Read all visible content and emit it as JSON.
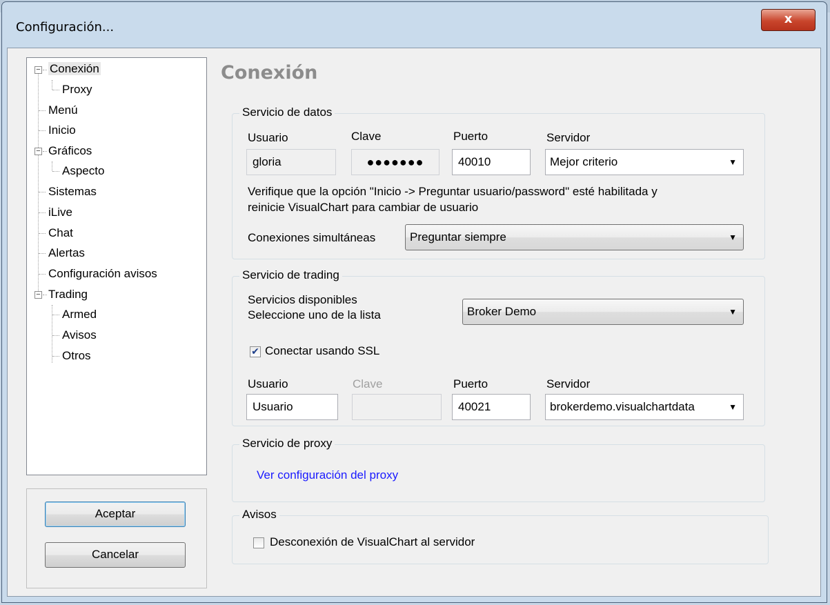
{
  "window": {
    "title": "Configuración...",
    "close_label": "x"
  },
  "tree": {
    "items": [
      {
        "label": "Conexión"
      },
      {
        "label": "Proxy"
      },
      {
        "label": "Menú"
      },
      {
        "label": "Inicio"
      },
      {
        "label": "Gráficos"
      },
      {
        "label": "Aspecto"
      },
      {
        "label": "Sistemas"
      },
      {
        "label": "iLive"
      },
      {
        "label": "Chat"
      },
      {
        "label": "Alertas"
      },
      {
        "label": "Configuración avisos"
      },
      {
        "label": "Trading"
      },
      {
        "label": "Armed"
      },
      {
        "label": "Avisos"
      },
      {
        "label": "Otros"
      }
    ],
    "expander_symbol": "−"
  },
  "buttons": {
    "accept": "Aceptar",
    "cancel": "Cancelar"
  },
  "page_title": "Conexión",
  "data_service": {
    "group_label": "Servicio de datos",
    "user_label": "Usuario",
    "user_value": "gloria",
    "password_label": "Clave",
    "password_value": "●●●●●●●",
    "port_label": "Puerto",
    "port_value": "40010",
    "server_label": "Servidor",
    "server_value": "Mejor criterio",
    "note_line1": "Verifique que la opción \"Inicio -> Preguntar usuario/password\" esté habilitada y",
    "note_line2": "reinicie VisualChart para cambiar de usuario",
    "simultaneous_label": "Conexiones simultáneas",
    "simultaneous_value": "Preguntar siempre"
  },
  "trading_service": {
    "group_label": "Servicio de trading",
    "available_label": "Servicios disponibles",
    "select_hint": "Seleccione uno de la lista",
    "broker_value": "Broker Demo",
    "ssl_label": "Conectar usando SSL",
    "ssl_checked": true,
    "ssl_check_mark": "✔",
    "user_label": "Usuario",
    "user_value": "Usuario",
    "password_label": "Clave",
    "password_value": "",
    "port_label": "Puerto",
    "port_value": "40021",
    "server_label": "Servidor",
    "server_value": "brokerdemo.visualchartdata"
  },
  "proxy_service": {
    "group_label": "Servicio de proxy",
    "link_text": "Ver configuración del proxy"
  },
  "alerts": {
    "group_label": "Avisos",
    "disconnect_label": "Desconexión de VisualChart al servidor",
    "disconnect_checked": false
  },
  "dropdown_arrow": "▼",
  "colors": {
    "title_gray": "#8c8c8c",
    "link_blue": "#1a1aff",
    "close_red": "#c9452c"
  }
}
